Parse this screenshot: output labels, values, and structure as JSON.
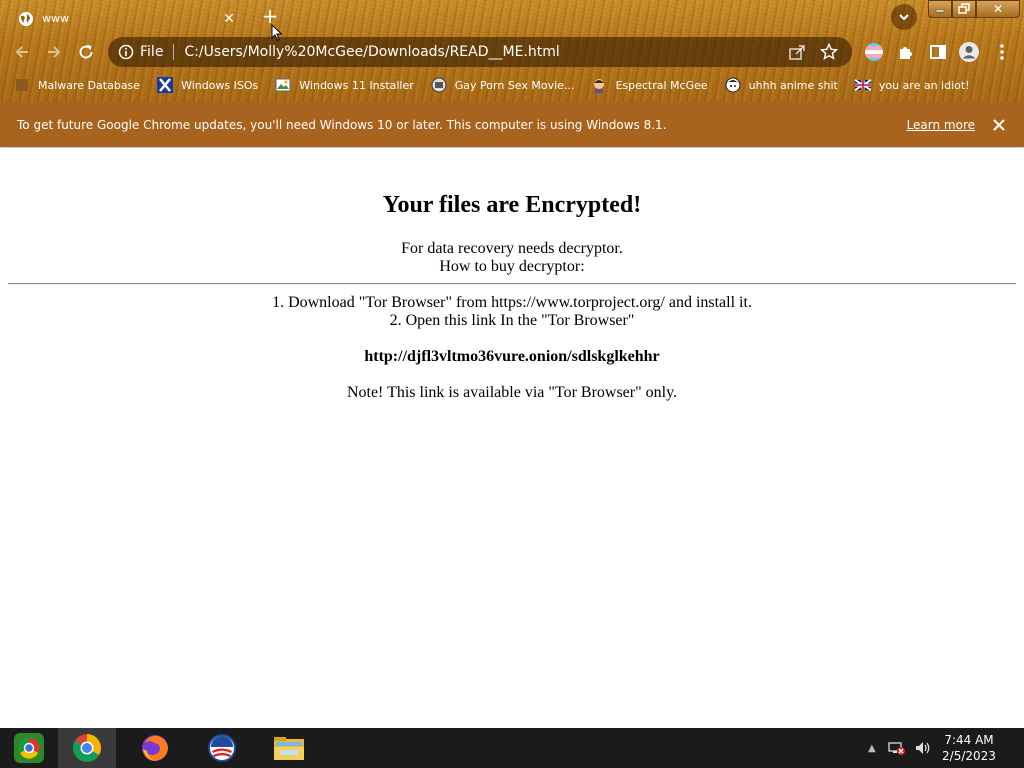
{
  "tab": {
    "title": "www",
    "icon": "globe-icon"
  },
  "toolbar": {
    "scheme_label": "File",
    "url": "C:/Users/Molly%20McGee/Downloads/READ__ME.html"
  },
  "bookmarks": [
    {
      "label": "Malware Database",
      "icon": "bookmark-favicon"
    },
    {
      "label": "Windows ISOs",
      "icon": "x-logo-icon"
    },
    {
      "label": "Windows 11 Installer",
      "icon": "image-icon"
    },
    {
      "label": "Gay Porn Sex Movie...",
      "icon": "bookmark-favicon"
    },
    {
      "label": "Espectral McGee",
      "icon": "avatar-icon"
    },
    {
      "label": "uhhh anime shit",
      "icon": "anime-avatar-icon"
    },
    {
      "label": "you are an idiot!",
      "icon": "uk-flag-icon"
    }
  ],
  "infobar": {
    "message": "To get future Google Chrome updates, you'll need Windows 10 or later. This computer is using Windows 8.1.",
    "link": "Learn more"
  },
  "page": {
    "heading": "Your files are Encrypted!",
    "line1": "For data recovery needs decryptor.",
    "line2": "How to buy decryptor:",
    "step1": "1. Download \"Tor Browser\" from https://www.torproject.org/ and install it.",
    "step2": "2. Open this link In the \"Tor Browser\"",
    "onion_link": "http://djfl3vltmo36vure.onion/sdlskglkehhr",
    "note": "Note! This link is available via \"Tor Browser\" only."
  },
  "taskbar": {
    "apps": [
      "start-button",
      "chrome-icon",
      "firefox-icon",
      "obama-logo-icon",
      "file-explorer-icon"
    ],
    "time": "7:44 AM",
    "date": "2/5/2023"
  },
  "colors": {
    "infobar": "#a8631f",
    "chrome_wood": "#b8781c",
    "taskbar": "#1b1b1b"
  }
}
